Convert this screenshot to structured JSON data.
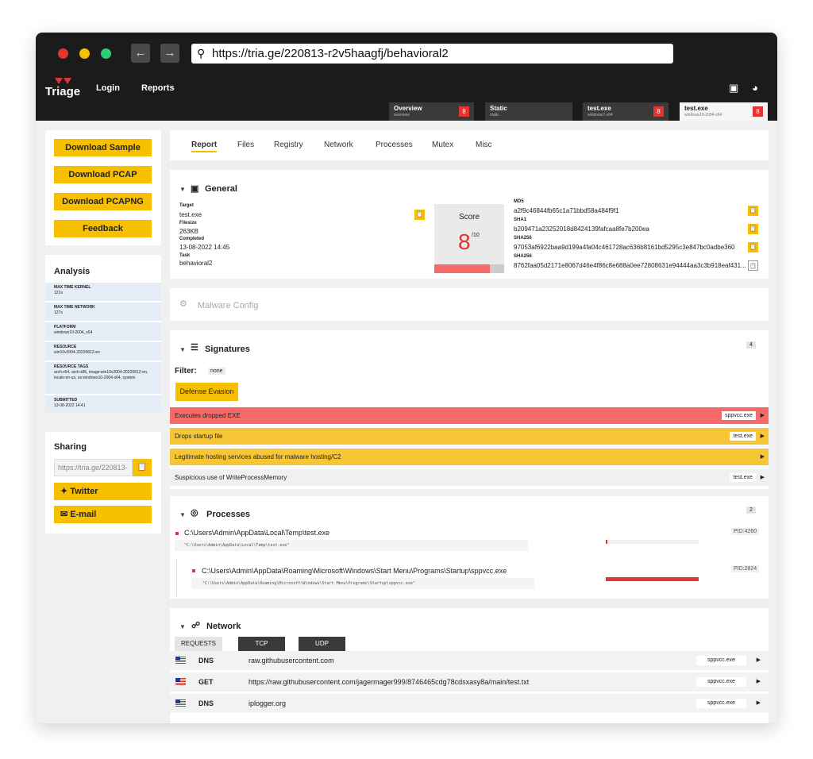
{
  "browser": {
    "url": "https://tria.ge/220813-r2v5haagfj/behavioral2",
    "back_label": "←",
    "forward_label": "→"
  },
  "header": {
    "logo_text": "Triage",
    "nav": [
      "Login",
      "Reports"
    ],
    "tabs": [
      {
        "title": "Overview",
        "sub": "overview",
        "badge": "8"
      },
      {
        "title": "Static",
        "sub": "static",
        "badge": ""
      },
      {
        "title": "test.exe",
        "sub": "windows7-x64",
        "badge": "8"
      },
      {
        "title": "test.exe",
        "sub": "windows10-2004-x64",
        "badge": "8"
      }
    ]
  },
  "sidebar": {
    "downloads": [
      "Download Sample",
      "Download PCAP",
      "Download PCAPNG",
      "Feedback"
    ],
    "analysis_title": "Analysis",
    "analysis": [
      {
        "key": "MAX TIME KERNEL",
        "value": "121s"
      },
      {
        "key": "MAX TIME NETWORK",
        "value": "127s"
      },
      {
        "key": "PLATFORM",
        "value": "windows10-2004_x64"
      },
      {
        "key": "RESOURCE",
        "value": "win10v2004-20220812-en"
      },
      {
        "key": "RESOURCE TAGS",
        "value": "arch:x64, arch:x86, image:win10v2004-20220812-en, locale:en-us, os:windows10-2004-x64, system"
      },
      {
        "key": "SUBMITTED",
        "value": "13-08-2022 14:41"
      }
    ],
    "sharing_title": "Sharing",
    "share_url": "https://tria.ge/220813-",
    "twitter_label": "Twitter",
    "email_label": "E-mail"
  },
  "tabs": [
    "Report",
    "Files",
    "Registry",
    "Network",
    "Processes",
    "Mutex",
    "Misc"
  ],
  "general": {
    "title": "General",
    "target_label": "Target",
    "target": "test.exe",
    "filesize_label": "Filesize",
    "filesize": "263KB",
    "completed_label": "Completed",
    "completed": "13-08-2022 14:45",
    "task_label": "Task",
    "task": "behavioral2",
    "score_label": "Score",
    "score": "8",
    "score_max": "/10",
    "score_fraction": 0.8,
    "hashes": [
      {
        "label": "MD5",
        "value": "a2f9c46844fb65c1a71bbd58a484f9f1"
      },
      {
        "label": "SHA1",
        "value": "b209471a23252018d8424139fafcaa8fe7b200ea"
      },
      {
        "label": "SHA256",
        "value": "97053af6922baa9d199a4fa04c461728ac636b8161bd5295c3e847bc0adbe360"
      },
      {
        "label": "SHA256",
        "value": "8762faa05d2171e8067d46e4f86c8e688a0ee72808631e94444aa3c3b918eaf431..."
      }
    ]
  },
  "malware_config": {
    "title": "Malware Config"
  },
  "signatures": {
    "title": "Signatures",
    "count": "4",
    "filter_label": "Filter:",
    "filter_value": "none",
    "filter_button": "Defense Evasion",
    "items": [
      {
        "text": "Executes dropped EXE",
        "tag": "sppvcc.exe",
        "color": "#f66a6a"
      },
      {
        "text": "Drops startup file",
        "tag": "test.exe",
        "color": "#f6c637"
      },
      {
        "text": "Legitimate hosting services abused for malware hosting/C2",
        "tag": "",
        "color": "#f6c637"
      },
      {
        "text": "Suspicious use of WriteProcessMemory",
        "tag": "test.exe",
        "color": "#f0f0f0"
      }
    ]
  },
  "processes": {
    "title": "Processes",
    "count": "2",
    "items": [
      {
        "path": "C:\\Users\\Admin\\AppData\\Local\\Temp\\test.exe",
        "cmd": "\"C:\\Users\\Admin\\AppData\\Local\\Temp\\test.exe\"",
        "pid": "PID:4260"
      },
      {
        "path": "C:\\Users\\Admin\\AppData\\Roaming\\Microsoft\\Windows\\Start Menu\\Programs\\Startup\\sppvcc.exe",
        "cmd": "\"C:\\Users\\Admin\\AppData\\Roaming\\Microsoft\\Windows\\Start Menu\\Programs\\Startup\\sppvcc.exe\"",
        "pid": "PID:2824"
      }
    ]
  },
  "network": {
    "title": "Network",
    "tabs": [
      "REQUESTS",
      "TCP",
      "UDP"
    ],
    "requests": [
      {
        "method": "DNS",
        "url": "raw.githubusercontent.com",
        "tag": "sppvcc.exe"
      },
      {
        "method": "GET",
        "url": "https://raw.githubusercontent.com/jagermager999/8746465cdg78cdsxasy8a/main/test.txt",
        "tag": "sppvcc.exe"
      },
      {
        "method": "DNS",
        "url": "iplogger.org",
        "tag": "sppvcc.exe"
      }
    ]
  },
  "colors": {
    "accent": "#f6bf00",
    "danger": "#e3342f",
    "warning": "#f6c637",
    "dark": "#1b1b1b"
  }
}
